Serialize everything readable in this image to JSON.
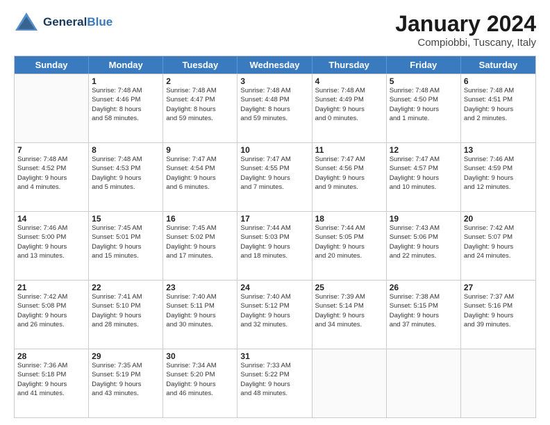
{
  "header": {
    "logo_line1": "General",
    "logo_line2": "Blue",
    "month": "January 2024",
    "location": "Compiobbi, Tuscany, Italy"
  },
  "weekdays": [
    "Sunday",
    "Monday",
    "Tuesday",
    "Wednesday",
    "Thursday",
    "Friday",
    "Saturday"
  ],
  "rows": [
    [
      {
        "day": "",
        "sunrise": "",
        "sunset": "",
        "daylight": ""
      },
      {
        "day": "1",
        "sunrise": "Sunrise: 7:48 AM",
        "sunset": "Sunset: 4:46 PM",
        "daylight": "Daylight: 8 hours",
        "daylight2": "and 58 minutes."
      },
      {
        "day": "2",
        "sunrise": "Sunrise: 7:48 AM",
        "sunset": "Sunset: 4:47 PM",
        "daylight": "Daylight: 8 hours",
        "daylight2": "and 59 minutes."
      },
      {
        "day": "3",
        "sunrise": "Sunrise: 7:48 AM",
        "sunset": "Sunset: 4:48 PM",
        "daylight": "Daylight: 8 hours",
        "daylight2": "and 59 minutes."
      },
      {
        "day": "4",
        "sunrise": "Sunrise: 7:48 AM",
        "sunset": "Sunset: 4:49 PM",
        "daylight": "Daylight: 9 hours",
        "daylight2": "and 0 minutes."
      },
      {
        "day": "5",
        "sunrise": "Sunrise: 7:48 AM",
        "sunset": "Sunset: 4:50 PM",
        "daylight": "Daylight: 9 hours",
        "daylight2": "and 1 minute."
      },
      {
        "day": "6",
        "sunrise": "Sunrise: 7:48 AM",
        "sunset": "Sunset: 4:51 PM",
        "daylight": "Daylight: 9 hours",
        "daylight2": "and 2 minutes."
      }
    ],
    [
      {
        "day": "7",
        "sunrise": "Sunrise: 7:48 AM",
        "sunset": "Sunset: 4:52 PM",
        "daylight": "Daylight: 9 hours",
        "daylight2": "and 4 minutes."
      },
      {
        "day": "8",
        "sunrise": "Sunrise: 7:48 AM",
        "sunset": "Sunset: 4:53 PM",
        "daylight": "Daylight: 9 hours",
        "daylight2": "and 5 minutes."
      },
      {
        "day": "9",
        "sunrise": "Sunrise: 7:47 AM",
        "sunset": "Sunset: 4:54 PM",
        "daylight": "Daylight: 9 hours",
        "daylight2": "and 6 minutes."
      },
      {
        "day": "10",
        "sunrise": "Sunrise: 7:47 AM",
        "sunset": "Sunset: 4:55 PM",
        "daylight": "Daylight: 9 hours",
        "daylight2": "and 7 minutes."
      },
      {
        "day": "11",
        "sunrise": "Sunrise: 7:47 AM",
        "sunset": "Sunset: 4:56 PM",
        "daylight": "Daylight: 9 hours",
        "daylight2": "and 9 minutes."
      },
      {
        "day": "12",
        "sunrise": "Sunrise: 7:47 AM",
        "sunset": "Sunset: 4:57 PM",
        "daylight": "Daylight: 9 hours",
        "daylight2": "and 10 minutes."
      },
      {
        "day": "13",
        "sunrise": "Sunrise: 7:46 AM",
        "sunset": "Sunset: 4:59 PM",
        "daylight": "Daylight: 9 hours",
        "daylight2": "and 12 minutes."
      }
    ],
    [
      {
        "day": "14",
        "sunrise": "Sunrise: 7:46 AM",
        "sunset": "Sunset: 5:00 PM",
        "daylight": "Daylight: 9 hours",
        "daylight2": "and 13 minutes."
      },
      {
        "day": "15",
        "sunrise": "Sunrise: 7:45 AM",
        "sunset": "Sunset: 5:01 PM",
        "daylight": "Daylight: 9 hours",
        "daylight2": "and 15 minutes."
      },
      {
        "day": "16",
        "sunrise": "Sunrise: 7:45 AM",
        "sunset": "Sunset: 5:02 PM",
        "daylight": "Daylight: 9 hours",
        "daylight2": "and 17 minutes."
      },
      {
        "day": "17",
        "sunrise": "Sunrise: 7:44 AM",
        "sunset": "Sunset: 5:03 PM",
        "daylight": "Daylight: 9 hours",
        "daylight2": "and 18 minutes."
      },
      {
        "day": "18",
        "sunrise": "Sunrise: 7:44 AM",
        "sunset": "Sunset: 5:05 PM",
        "daylight": "Daylight: 9 hours",
        "daylight2": "and 20 minutes."
      },
      {
        "day": "19",
        "sunrise": "Sunrise: 7:43 AM",
        "sunset": "Sunset: 5:06 PM",
        "daylight": "Daylight: 9 hours",
        "daylight2": "and 22 minutes."
      },
      {
        "day": "20",
        "sunrise": "Sunrise: 7:42 AM",
        "sunset": "Sunset: 5:07 PM",
        "daylight": "Daylight: 9 hours",
        "daylight2": "and 24 minutes."
      }
    ],
    [
      {
        "day": "21",
        "sunrise": "Sunrise: 7:42 AM",
        "sunset": "Sunset: 5:08 PM",
        "daylight": "Daylight: 9 hours",
        "daylight2": "and 26 minutes."
      },
      {
        "day": "22",
        "sunrise": "Sunrise: 7:41 AM",
        "sunset": "Sunset: 5:10 PM",
        "daylight": "Daylight: 9 hours",
        "daylight2": "and 28 minutes."
      },
      {
        "day": "23",
        "sunrise": "Sunrise: 7:40 AM",
        "sunset": "Sunset: 5:11 PM",
        "daylight": "Daylight: 9 hours",
        "daylight2": "and 30 minutes."
      },
      {
        "day": "24",
        "sunrise": "Sunrise: 7:40 AM",
        "sunset": "Sunset: 5:12 PM",
        "daylight": "Daylight: 9 hours",
        "daylight2": "and 32 minutes."
      },
      {
        "day": "25",
        "sunrise": "Sunrise: 7:39 AM",
        "sunset": "Sunset: 5:14 PM",
        "daylight": "Daylight: 9 hours",
        "daylight2": "and 34 minutes."
      },
      {
        "day": "26",
        "sunrise": "Sunrise: 7:38 AM",
        "sunset": "Sunset: 5:15 PM",
        "daylight": "Daylight: 9 hours",
        "daylight2": "and 37 minutes."
      },
      {
        "day": "27",
        "sunrise": "Sunrise: 7:37 AM",
        "sunset": "Sunset: 5:16 PM",
        "daylight": "Daylight: 9 hours",
        "daylight2": "and 39 minutes."
      }
    ],
    [
      {
        "day": "28",
        "sunrise": "Sunrise: 7:36 AM",
        "sunset": "Sunset: 5:18 PM",
        "daylight": "Daylight: 9 hours",
        "daylight2": "and 41 minutes."
      },
      {
        "day": "29",
        "sunrise": "Sunrise: 7:35 AM",
        "sunset": "Sunset: 5:19 PM",
        "daylight": "Daylight: 9 hours",
        "daylight2": "and 43 minutes."
      },
      {
        "day": "30",
        "sunrise": "Sunrise: 7:34 AM",
        "sunset": "Sunset: 5:20 PM",
        "daylight": "Daylight: 9 hours",
        "daylight2": "and 46 minutes."
      },
      {
        "day": "31",
        "sunrise": "Sunrise: 7:33 AM",
        "sunset": "Sunset: 5:22 PM",
        "daylight": "Daylight: 9 hours",
        "daylight2": "and 48 minutes."
      },
      {
        "day": "",
        "sunrise": "",
        "sunset": "",
        "daylight": "",
        "daylight2": ""
      },
      {
        "day": "",
        "sunrise": "",
        "sunset": "",
        "daylight": "",
        "daylight2": ""
      },
      {
        "day": "",
        "sunrise": "",
        "sunset": "",
        "daylight": "",
        "daylight2": ""
      }
    ]
  ]
}
